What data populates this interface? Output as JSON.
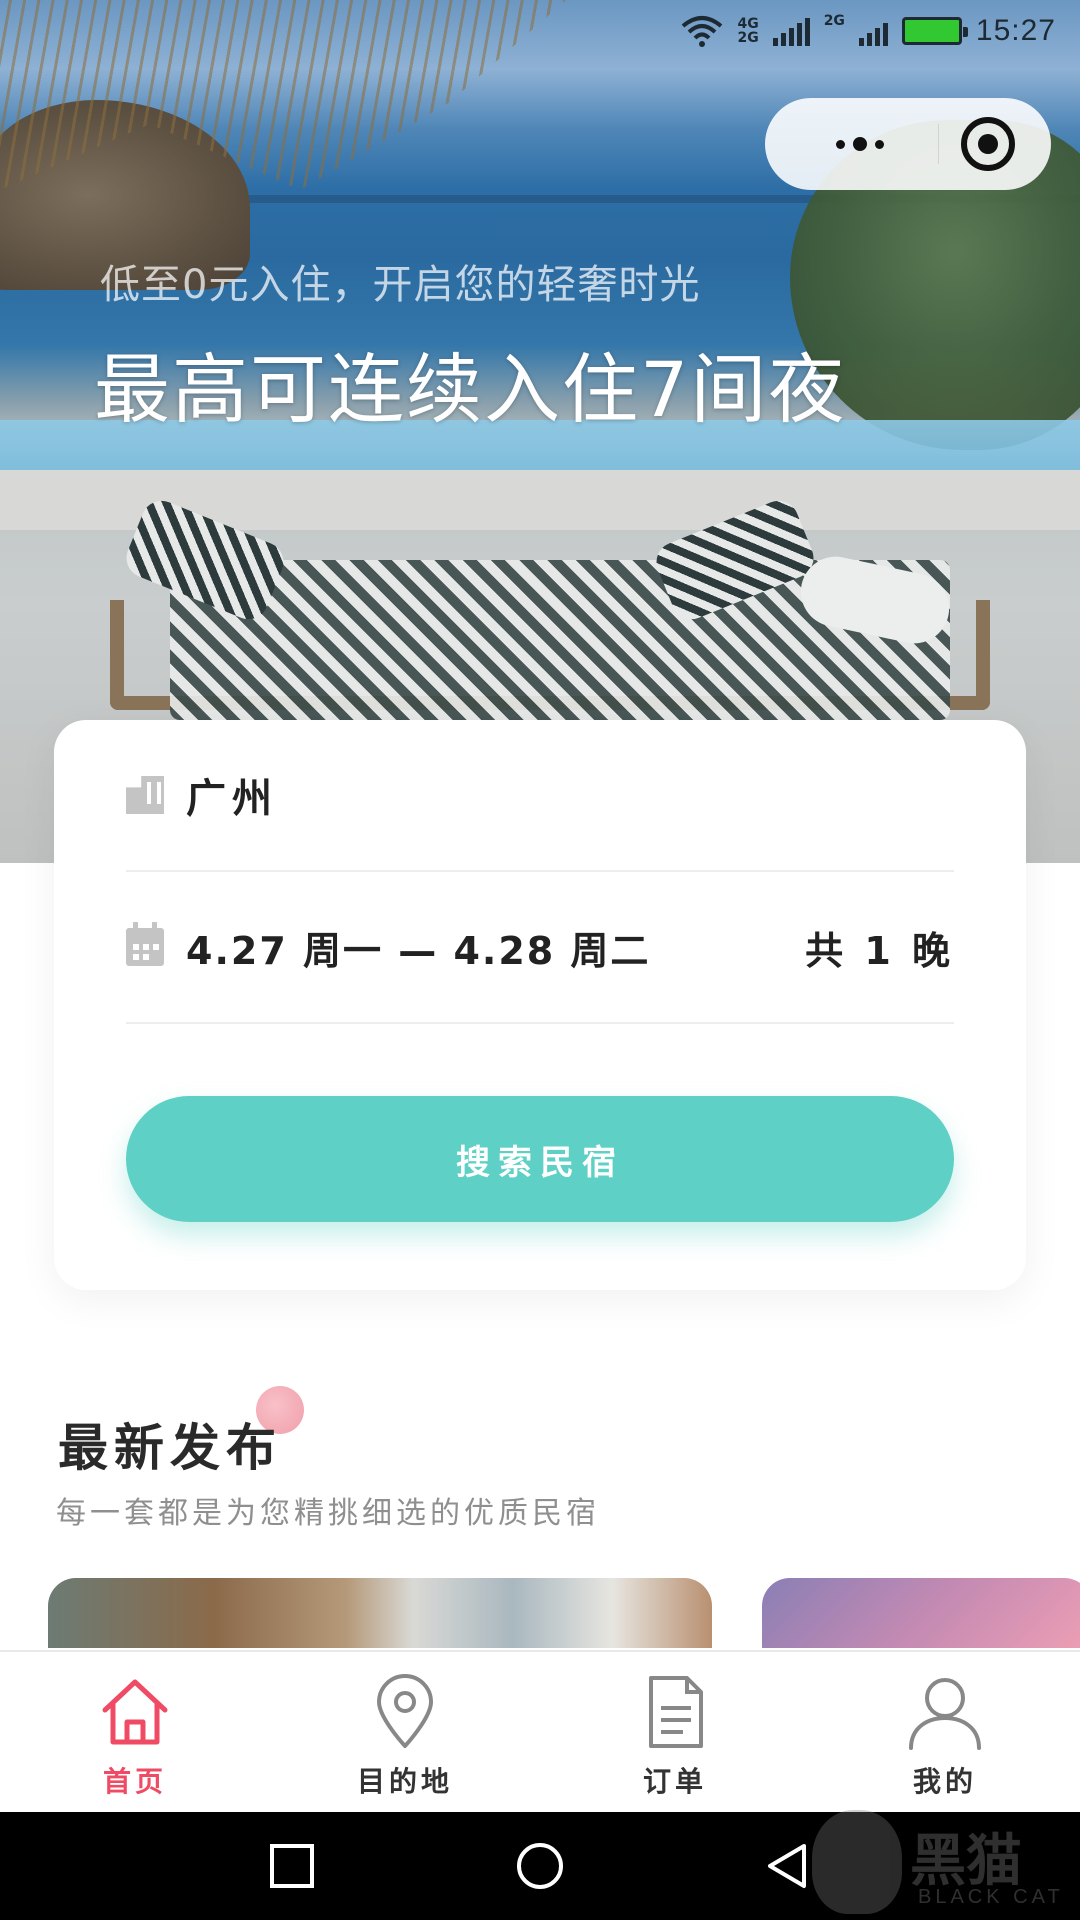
{
  "status_bar": {
    "network_primary": "4G",
    "network_secondary": "2G",
    "network_tertiary": "2G",
    "time": "15:27",
    "battery_color": "#32c832"
  },
  "hero": {
    "subtitle": "低至0元入住，开启您的轻奢时光",
    "title": "最高可连续入住7间夜"
  },
  "capsule": {
    "more_icon": "more-dots-icon",
    "close_icon": "target-close-icon"
  },
  "search": {
    "city": "广州",
    "date_range": "4.27 周一 — 4.28 周二",
    "nights": "共 1 晚",
    "button_label": "搜索民宿",
    "button_color": "#5fd0c5"
  },
  "section": {
    "title": "最新发布",
    "subtitle": "每一套都是为您精挑细选的优质民宿"
  },
  "tabbar": {
    "active_color": "#f04b64",
    "items": [
      {
        "label": "首页",
        "icon": "home-icon"
      },
      {
        "label": "目的地",
        "icon": "location-pin-icon"
      },
      {
        "label": "订单",
        "icon": "document-icon"
      },
      {
        "label": "我的",
        "icon": "user-icon"
      }
    ]
  },
  "watermark": {
    "text": "黑猫",
    "sub": "BLACK CAT"
  }
}
